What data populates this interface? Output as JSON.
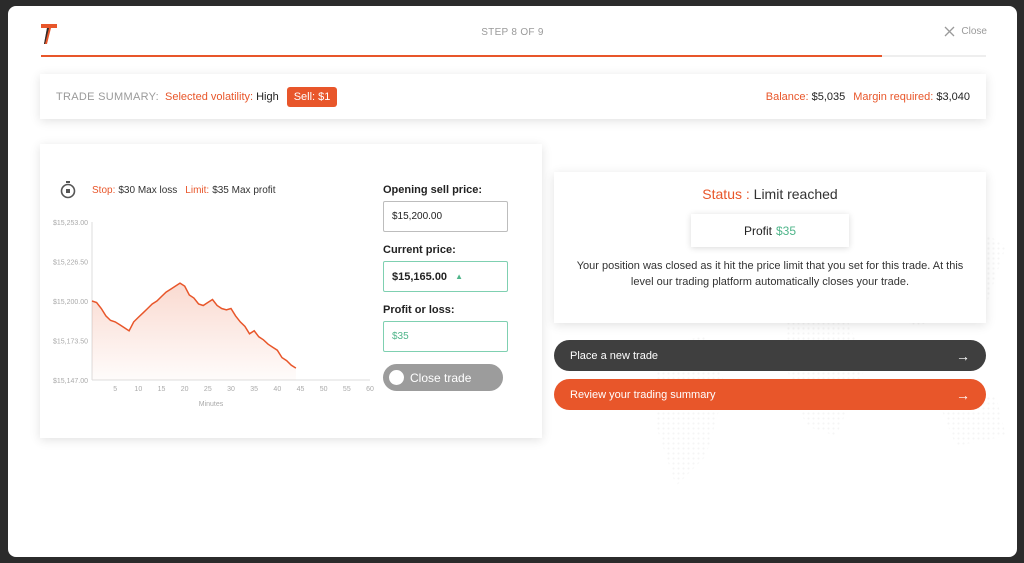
{
  "header": {
    "step": "STEP 8 OF 9",
    "close_label": "Close",
    "progress": 0.89
  },
  "summary": {
    "title": "TRADE SUMMARY:",
    "volatility_label": "Selected volatility:",
    "volatility_value": "High",
    "sell_badge": "Sell: $1",
    "balance_label": "Balance:",
    "balance_value": "$5,035",
    "margin_label": "Margin required:",
    "margin_value": "$3,040"
  },
  "limits": {
    "stop_label": "Stop:",
    "stop_value": "$30 Max loss",
    "limit_label": "Limit:",
    "limit_value": "$35 Max profit"
  },
  "chart_data": {
    "type": "area",
    "xlabel": "Minutes",
    "ylabel": "",
    "xlim": [
      0,
      60
    ],
    "ylim": [
      15147.0,
      15253.0
    ],
    "x_ticks": [
      5,
      10,
      15,
      20,
      25,
      30,
      35,
      40,
      45,
      50,
      55,
      60
    ],
    "y_ticks": [
      "$15,253.00",
      "$15,226.50",
      "$15,200.00",
      "$15,173.50",
      "$15,147.00"
    ],
    "x": [
      0,
      1,
      2,
      3,
      4,
      5,
      6,
      7,
      8,
      9,
      10,
      11,
      12,
      13,
      14,
      15,
      16,
      17,
      18,
      19,
      20,
      21,
      22,
      23,
      24,
      25,
      26,
      27,
      28,
      29,
      30,
      31,
      32,
      33,
      34,
      35,
      36,
      37,
      38,
      39,
      40,
      41,
      42,
      43,
      44
    ],
    "y": [
      15200,
      15199,
      15195,
      15190,
      15187,
      15186,
      15184,
      15182,
      15180,
      15186,
      15189,
      15192,
      15195,
      15198,
      15200,
      15203,
      15206,
      15208,
      15210,
      15212,
      15210,
      15204,
      15202,
      15198,
      15197,
      15199,
      15201,
      15197,
      15195,
      15194,
      15195,
      15190,
      15186,
      15183,
      15178,
      15180,
      15176,
      15174,
      15171,
      15169,
      15167,
      15162,
      15160,
      15157,
      15155
    ]
  },
  "fields": {
    "opening_label": "Opening sell price:",
    "opening_value": "$15,200.00",
    "current_label": "Current price:",
    "current_value": "$15,165.00",
    "pl_label": "Profit or loss:",
    "pl_value": "$35",
    "close_trade": "Close trade"
  },
  "status": {
    "label": "Status :",
    "value": "Limit reached",
    "profit_label": "Profit",
    "profit_value": "$35",
    "message": "Your position was closed as it hit the price limit that you set for this trade. At this level our trading platform automatically closes your trade."
  },
  "actions": {
    "new_trade": "Place a new trade",
    "review": "Review your trading summary"
  },
  "colors": {
    "accent": "#e8562a",
    "positive": "#4fb58a",
    "dark_button": "#3f3f3f"
  }
}
